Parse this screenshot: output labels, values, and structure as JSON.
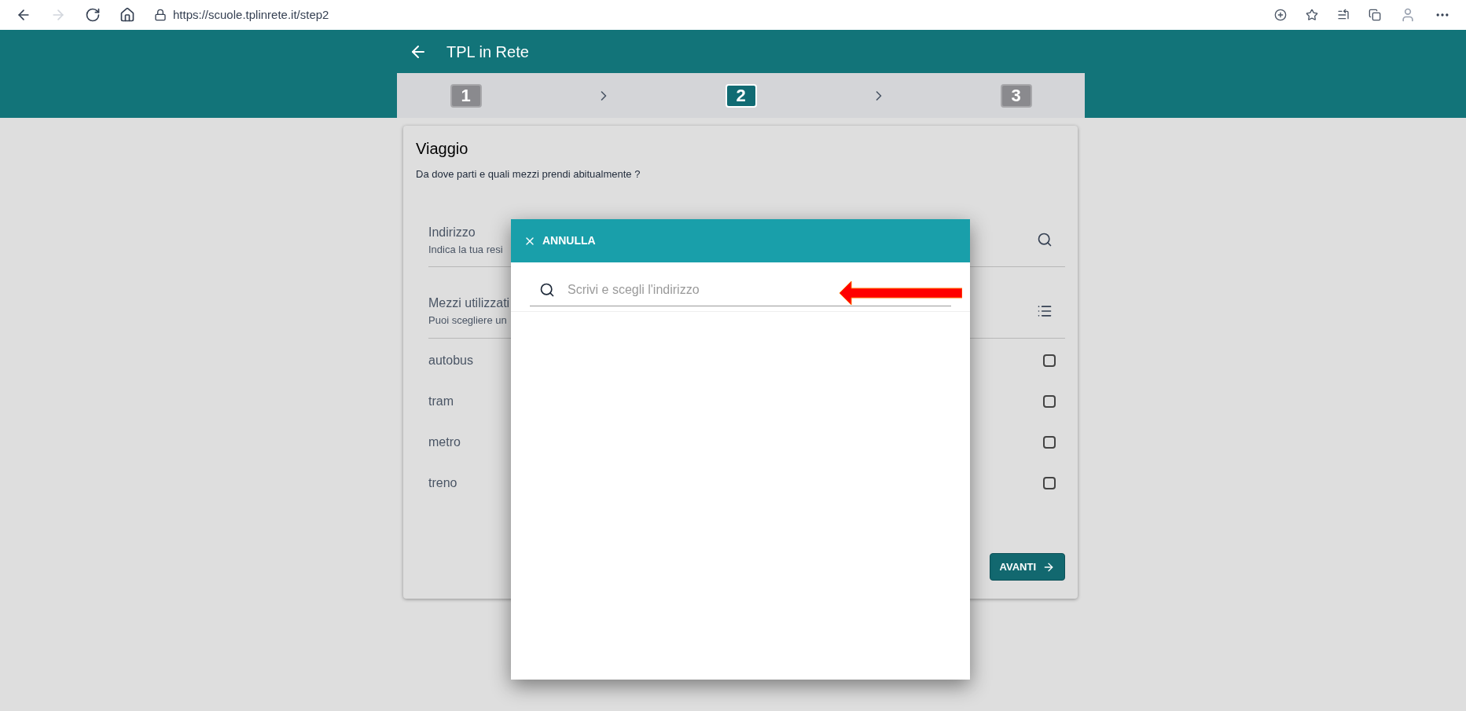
{
  "browser": {
    "url": "https://scuole.tplinrete.it/step2"
  },
  "app_bar": {
    "title": "TPL in Rete"
  },
  "stepper": [
    {
      "label": "1",
      "selected": false
    },
    {
      "label": "2",
      "selected": true
    },
    {
      "label": "3",
      "selected": false
    }
  ],
  "card": {
    "title": "Viaggio",
    "subtitle": "Da dove parti e quali mezzi prendi abitualmente ?",
    "fields": [
      {
        "kind": "search",
        "label": "Indirizzo",
        "hint": "Indica la tua resi"
      },
      {
        "kind": "list",
        "label": "Mezzi utilizzati",
        "hint": "Puoi scegliere un"
      }
    ],
    "options": [
      {
        "label": "autobus",
        "checked": false
      },
      {
        "label": "tram",
        "checked": false
      },
      {
        "label": "metro",
        "checked": false
      },
      {
        "label": "treno",
        "checked": false
      }
    ],
    "next_button": "AVANTI"
  },
  "dialog": {
    "cancel_button": "ANNULLA",
    "search": {
      "placeholder": "Scrivi e scegli l'indirizzo"
    }
  }
}
